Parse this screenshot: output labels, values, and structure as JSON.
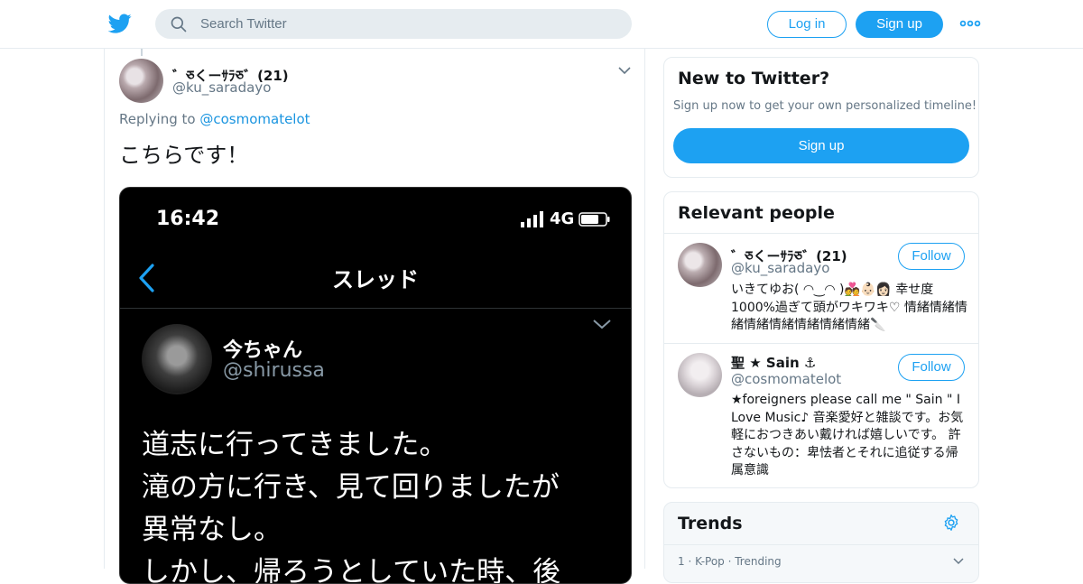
{
  "header": {
    "search_placeholder": "Search Twitter",
    "login_label": "Log in",
    "signup_label": "Sign up"
  },
  "tweet": {
    "author_name": "༺༻くーｻﾗﾀ༺༻༼(21)",
    "author_display": "゛ཅくーｻﾗཅ゛(21)",
    "author_handle": "@ku_saradayo",
    "replying_prefix": "Replying to",
    "replying_to": "@cosmomatelot",
    "text": "こちらです！",
    "screenshot": {
      "time": "16:42",
      "network": "4G",
      "title": "スレッド",
      "name": "今ちゃん",
      "handle": "@shirussa",
      "body": "道志に行ってきました。\n滝の方に行き、見て回りましたが\n異常なし。\nしかし、帰ろうとしていた時、後"
    }
  },
  "sidebar": {
    "new_to_twitter": {
      "title": "New to Twitter?",
      "subtitle": "Sign up now to get your own personalized timeline!",
      "signup_label": "Sign up"
    },
    "relevant_people": {
      "title": "Relevant people",
      "people": [
        {
          "name": "゛ཅくーｻﾗཅ゛(21)",
          "handle": "@ku_saradayo",
          "follow_label": "Follow",
          "bio": "いきてゆお( ◠‿◠ )💑👶🏻👩🏻 幸せ度1000%過ぎて頭がワキワキ♡ 情緒情緒情緒情緒情緒情緒情緒情緒🔪"
        },
        {
          "name": "聖 ★ Sain ⚓",
          "handle": "@cosmomatelot",
          "follow_label": "Follow",
          "bio": "★foreigners please call me \" Sain \" I Love Music♪ 音楽愛好と雑談です。お気軽におつきあい戴ければ嬉しいです。 許さないもの：卑怯者とそれに追従する帰属意識"
        }
      ]
    },
    "trends": {
      "title": "Trends",
      "first_item_meta": "1 · K-Pop · Trending"
    }
  },
  "colors": {
    "brand": "#1da1f2",
    "link": "#1b95e0",
    "muted": "#657786",
    "border": "#e6ecf0"
  },
  "icons": [
    "twitter-bird-icon",
    "search-icon",
    "more-dots-icon",
    "chevron-down-icon",
    "gear-icon",
    "back-arrow-icon",
    "signal-icon",
    "battery-icon"
  ]
}
